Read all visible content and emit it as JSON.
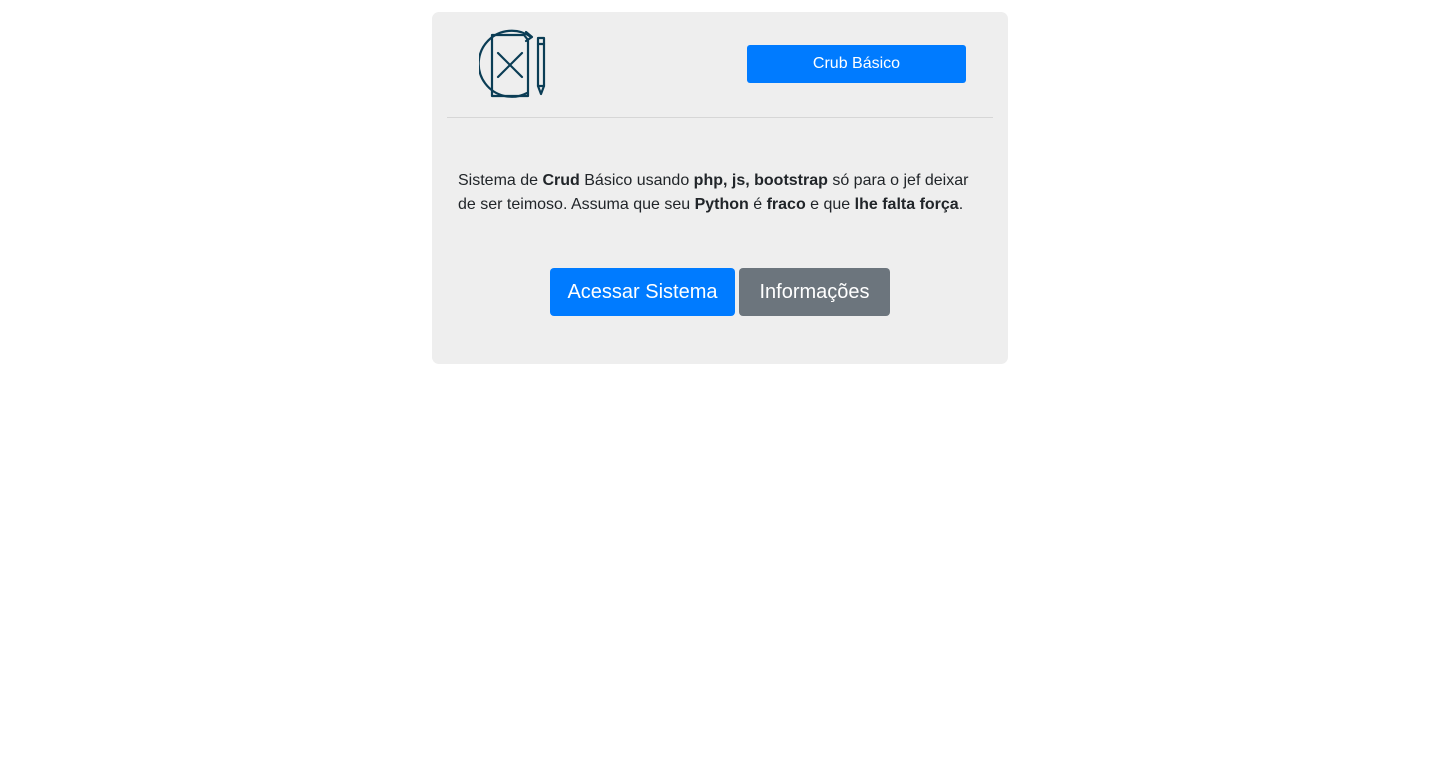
{
  "header": {
    "logo_icon": "document-cross-pencil-icon",
    "brand_button_label": "Crub Básico",
    "accent_color": "#007bff",
    "logo_color": "#0b3d55"
  },
  "description": {
    "segments": [
      {
        "text": "Sistema de ",
        "bold": false
      },
      {
        "text": "Crud",
        "bold": true
      },
      {
        "text": " Básico usando ",
        "bold": false
      },
      {
        "text": "php, js, bootstrap",
        "bold": true
      },
      {
        "text": " só para o jef deixar de ser teimoso. Assuma que seu ",
        "bold": false
      },
      {
        "text": "Python",
        "bold": true
      },
      {
        "text": " é ",
        "bold": false
      },
      {
        "text": "fraco",
        "bold": true
      },
      {
        "text": " e que ",
        "bold": false
      },
      {
        "text": "lhe falta força",
        "bold": true
      },
      {
        "text": ".",
        "bold": false
      }
    ]
  },
  "actions": {
    "primary_label": "Acessar Sistema",
    "secondary_label": "Informações",
    "primary_color": "#007bff",
    "secondary_color": "#6c757d"
  }
}
